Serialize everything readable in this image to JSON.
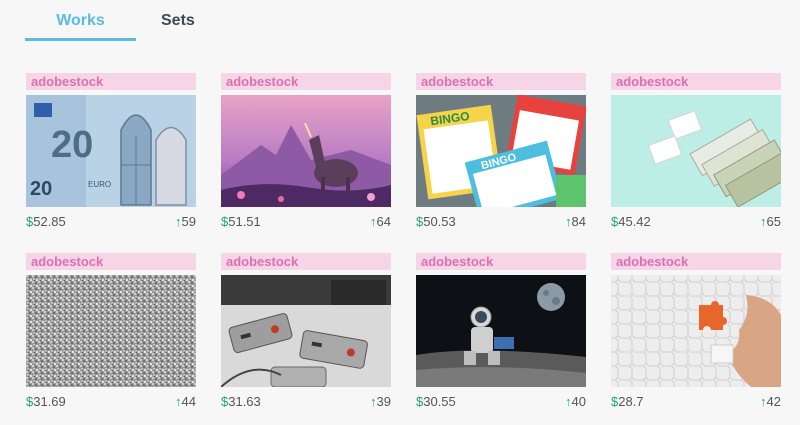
{
  "tabs": {
    "works": "Works",
    "sets": "Sets"
  },
  "accent_color": "#5bbbe2",
  "price_currency_symbol": "$",
  "upvote_icon": "arrow-up-icon",
  "cards": [
    {
      "source": "adobestock",
      "price": "52.85",
      "votes": "59",
      "subject": "20 euro banknote"
    },
    {
      "source": "adobestock",
      "price": "51.51",
      "votes": "64",
      "subject": "unicorn fantasy landscape"
    },
    {
      "source": "adobestock",
      "price": "50.53",
      "votes": "84",
      "subject": "bingo cards"
    },
    {
      "source": "adobestock",
      "price": "45.42",
      "votes": "65",
      "subject": "dollar bills fan"
    },
    {
      "source": "adobestock",
      "price": "31.69",
      "votes": "44",
      "subject": "static noise texture"
    },
    {
      "source": "adobestock",
      "price": "31.63",
      "votes": "39",
      "subject": "retro game controllers"
    },
    {
      "source": "adobestock",
      "price": "30.55",
      "votes": "40",
      "subject": "astronaut on moon with laptop"
    },
    {
      "source": "adobestock",
      "price": "28.7",
      "votes": "42",
      "subject": "white jigsaw puzzle"
    }
  ]
}
